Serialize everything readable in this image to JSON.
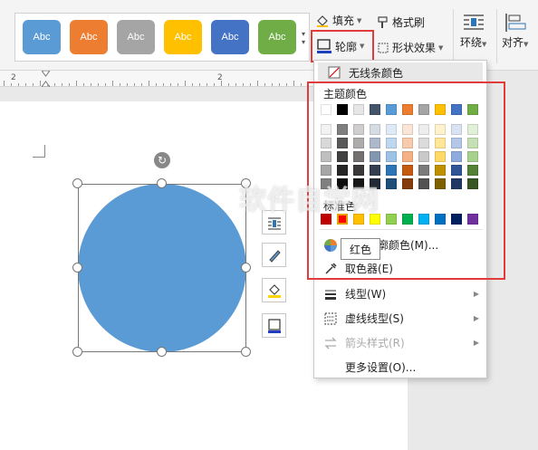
{
  "ribbon": {
    "style_label": "Abc",
    "style_colors": [
      "#5b9bd5",
      "#ed7d31",
      "#a5a5a5",
      "#ffc000",
      "#4472c4",
      "#70ad47"
    ],
    "fill_label": "填充",
    "format_painter_label": "格式刷",
    "outline_label": "轮廓",
    "shape_effect_label": "形状效果",
    "wrap_label": "环绕",
    "align_label": "对齐"
  },
  "ruler": {
    "labels": [
      "2",
      "2"
    ]
  },
  "menu": {
    "no_outline": "无线条颜色",
    "theme_colors_title": "主题颜色",
    "standard_colors_title": "标准色",
    "more_colors": "其他轮廓颜色(M)...",
    "eyedropper": "取色器(E)",
    "line_style": "线型(W)",
    "dash_style": "虚线线型(S)",
    "arrow_style": "箭头样式(R)",
    "more_settings": "更多设置(O)..."
  },
  "palette": {
    "theme_top": [
      "#ffffff",
      "#000000",
      "#e7e6e6",
      "#44546a",
      "#5b9bd5",
      "#ed7d31",
      "#a5a5a5",
      "#ffc000",
      "#4472c4",
      "#70ad47"
    ],
    "theme_shades": [
      [
        "#f2f2f2",
        "#7f7f7f",
        "#d0cece",
        "#d6dce4",
        "#deebf7",
        "#fbe5d6",
        "#ededed",
        "#fff2cc",
        "#dae3f3",
        "#e2f0d9"
      ],
      [
        "#d9d9d9",
        "#595959",
        "#aeabab",
        "#adb9ca",
        "#bdd7ee",
        "#f8cbad",
        "#dbdbdb",
        "#ffe699",
        "#b4c7e7",
        "#c5e0b4"
      ],
      [
        "#bfbfbf",
        "#404040",
        "#757070",
        "#8497b0",
        "#9dc3e6",
        "#f4b183",
        "#c9c9c9",
        "#ffd966",
        "#8faadc",
        "#a9d18e"
      ],
      [
        "#a6a6a6",
        "#262626",
        "#3a3838",
        "#333f50",
        "#2e75b6",
        "#c55a11",
        "#7b7b7b",
        "#bf9000",
        "#2f5597",
        "#538135"
      ],
      [
        "#808080",
        "#0d0d0d",
        "#171616",
        "#222a35",
        "#1f4e79",
        "#843c0c",
        "#525252",
        "#7f6000",
        "#203864",
        "#375623"
      ]
    ],
    "standard": [
      "#c00000",
      "#ff0000",
      "#ffc000",
      "#ffff00",
      "#92d050",
      "#00b050",
      "#00b0f0",
      "#0070c0",
      "#002060",
      "#7030a0"
    ]
  },
  "tooltip": "红色",
  "watermark": "软件自学网"
}
